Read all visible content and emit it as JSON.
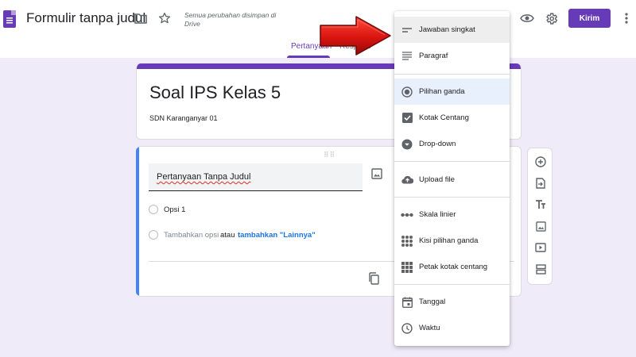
{
  "header": {
    "title": "Formulir tanpa judul",
    "save_status": "Semua perubahan disimpan di Drive",
    "send_label": "Kirim",
    "icons": [
      "forms-logo-icon",
      "folder-icon",
      "star-icon",
      "eye-icon",
      "gear-icon",
      "more-vert-icon"
    ]
  },
  "tabs": [
    {
      "label": "Pertanyaan",
      "active": true
    },
    {
      "label": "Respons",
      "active": false
    }
  ],
  "form": {
    "title": "Soal IPS Kelas 5",
    "description": "SDN Karanganyar 01"
  },
  "question": {
    "text": "Pertanyaan Tanpa Judul",
    "option1": "Opsi 1",
    "add_option": "Tambahkan opsi",
    "or": "atau",
    "add_other": "tambahkan \"Lainnya\""
  },
  "toolbar": [
    "add-question-icon",
    "import-questions-icon",
    "title-text-icon",
    "add-image-icon",
    "add-video-icon",
    "add-section-icon"
  ],
  "menu": {
    "items": [
      {
        "label": "Jawaban singkat",
        "icon": "short-answer-icon"
      },
      {
        "label": "Paragraf",
        "icon": "paragraph-icon"
      },
      {
        "label": "Pilihan ganda",
        "icon": "radio-button-icon"
      },
      {
        "label": "Kotak Centang",
        "icon": "checkbox-icon"
      },
      {
        "label": "Drop-down",
        "icon": "dropdown-icon"
      },
      {
        "label": "Upload file",
        "icon": "cloud-upload-icon"
      },
      {
        "label": "Skala linier",
        "icon": "linear-scale-icon"
      },
      {
        "label": "Kisi pilihan ganda",
        "icon": "grid-icon"
      },
      {
        "label": "Petak kotak centang",
        "icon": "checkbox-grid-icon"
      },
      {
        "label": "Tanggal",
        "icon": "calendar-icon"
      },
      {
        "label": "Waktu",
        "icon": "clock-icon"
      }
    ]
  },
  "colors": {
    "accent": "#673ab7",
    "background": "#f0ebf8",
    "question_bar": "#4285f4",
    "link": "#1a73e8",
    "arrow": "#e31b1b"
  }
}
